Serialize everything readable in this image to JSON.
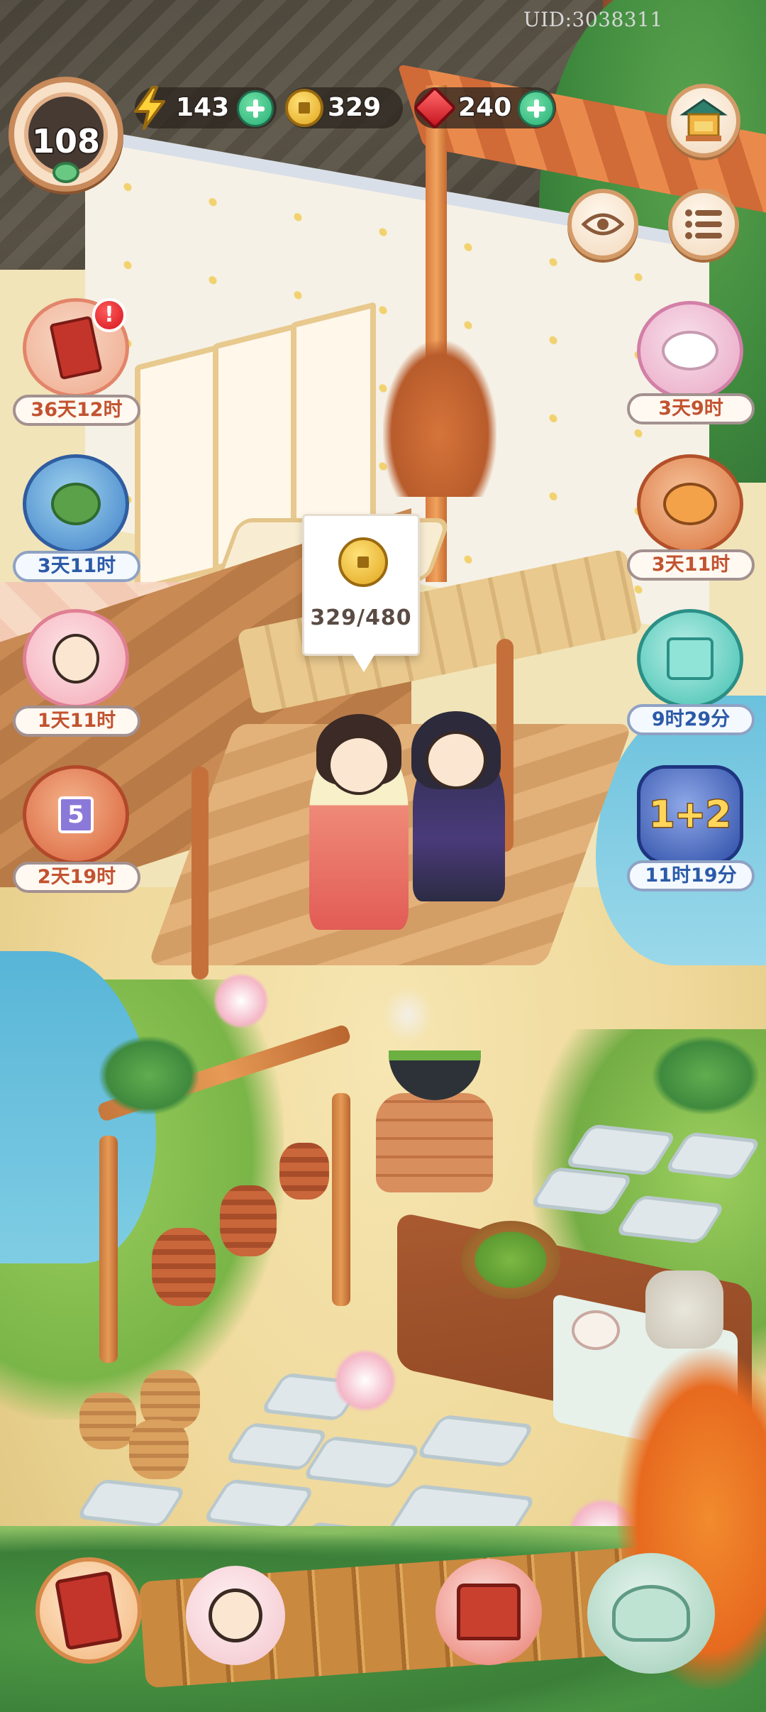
{
  "header": {
    "uid": "UID:3038311",
    "level": "108"
  },
  "resources": {
    "energy": {
      "value": "143",
      "icon": "lightning-bolt-icon"
    },
    "coins": {
      "value": "329",
      "icon": "gold-coin-icon"
    },
    "gems": {
      "value": "240",
      "icon": "red-gem-icon"
    }
  },
  "timers": {
    "left": [
      {
        "name": "book-scroll-event",
        "time": "36天12时",
        "has_alert": true,
        "alert": "!"
      },
      {
        "name": "melon-frog-event",
        "time": "3天11时"
      },
      {
        "name": "lady-portrait-event",
        "time": "1天11时"
      },
      {
        "name": "gift-box-five-event",
        "time": "2天19时",
        "badge": "5"
      }
    ],
    "right": [
      {
        "name": "white-cat-event",
        "time": "3天9时"
      },
      {
        "name": "orange-cat-event",
        "time": "3天11时"
      },
      {
        "name": "teal-gift-event",
        "time": "9时29分"
      },
      {
        "name": "one-plus-two-offer",
        "time": "11时19分",
        "art_text": "1+2"
      }
    ]
  },
  "coin_bubble": {
    "count": "329/480"
  },
  "colors": {
    "timer_text": "#c25330",
    "timer_text_blue": "#2b5aa8",
    "plus_green": "#29b07a",
    "accent_brown": "#c88a5a"
  }
}
